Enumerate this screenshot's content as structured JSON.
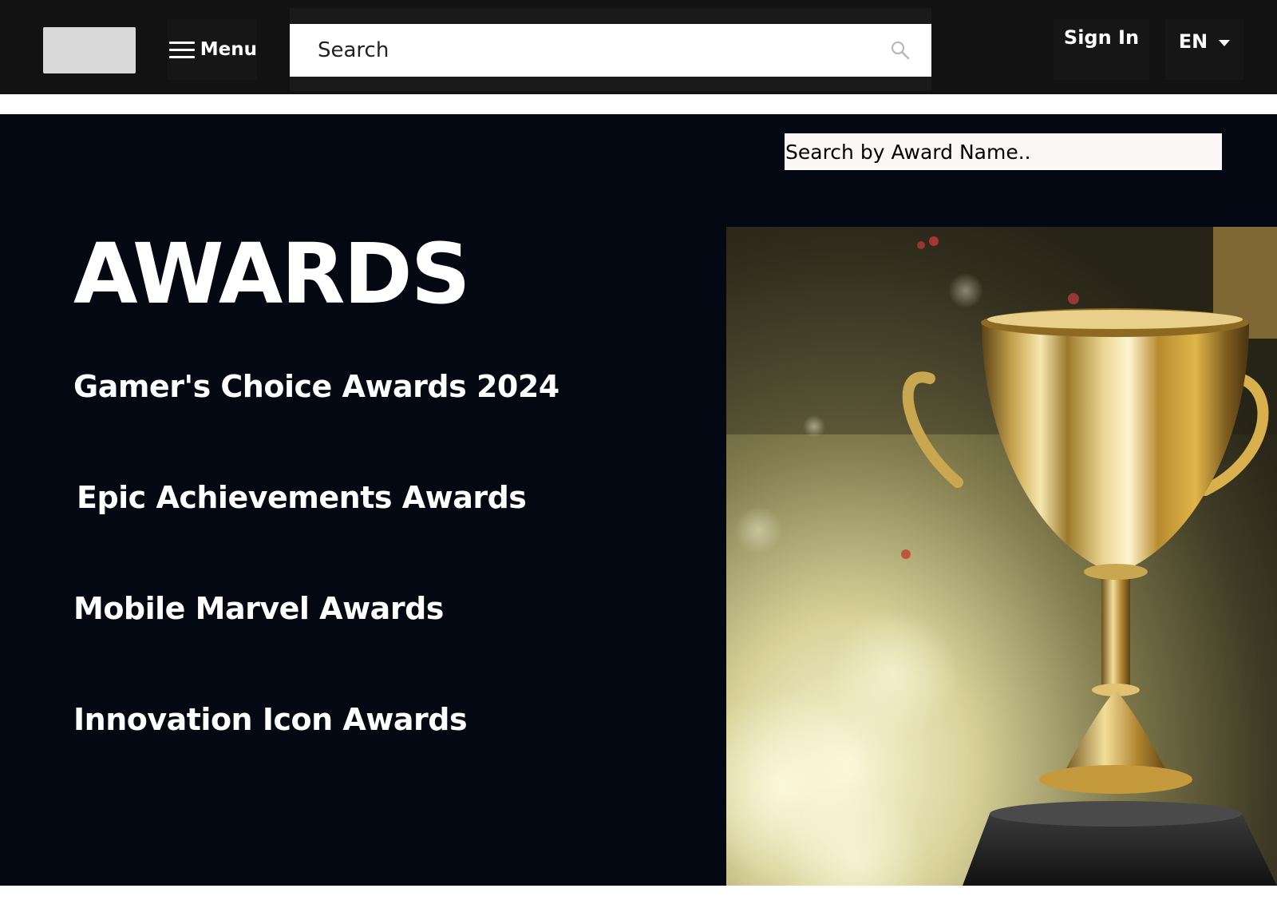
{
  "header": {
    "menu_label": "Menu",
    "search_placeholder": "Search",
    "signin_label": "Sign In",
    "language_label": "EN",
    "icons": {
      "menu": "hamburger-icon",
      "search": "magnifier-icon",
      "language": "caret-down-icon"
    }
  },
  "awards": {
    "search_placeholder": "Search by Award Name..",
    "title": "AWARDS",
    "items": [
      "Gamer's Choice Awards 2024",
      "Epic Achievements Awards",
      "Mobile Marvel Awards",
      "Innovation Icon Awards"
    ]
  },
  "colors": {
    "topbar_bg": "#121212",
    "main_bg": "#030812",
    "text": "#ffffff"
  }
}
